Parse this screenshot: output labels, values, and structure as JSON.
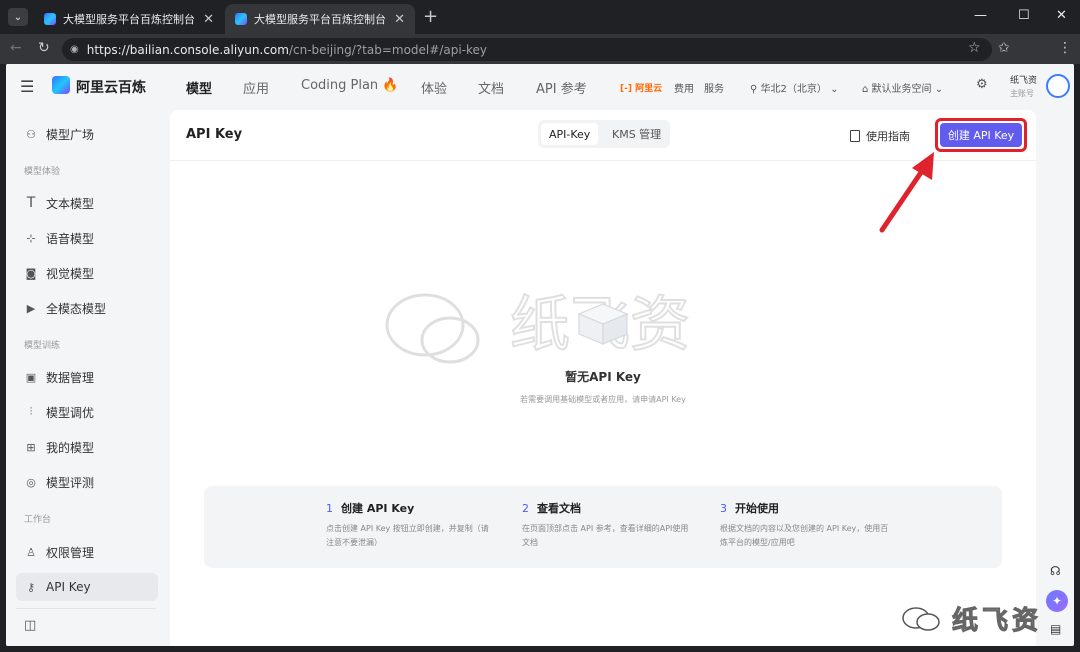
{
  "browser": {
    "tabs": [
      {
        "title": "大模型服务平台百炼控制台"
      },
      {
        "title": "大模型服务平台百炼控制台"
      }
    ],
    "url_host": "https://bailian.console.aliyun.com",
    "url_path": "/cn-beijing/?tab=model#/api-key"
  },
  "topnav": {
    "brand": "阿里云百炼",
    "items": [
      "模型",
      "应用",
      "Coding Plan",
      "体验",
      "文档",
      "API 参考"
    ],
    "aliyun_badge": "[-] 阿里云",
    "fee": "费用",
    "service": "服务",
    "region": "华北2（北京）",
    "workspace": "默认业务空间",
    "user_name": "纸飞资",
    "user_role": "主账号"
  },
  "sidebar": {
    "market": "模型广场",
    "sec_experience": "模型体验",
    "text_model": "文本模型",
    "voice_model": "语音模型",
    "vision_model": "视觉模型",
    "omni_model": "全模态模型",
    "sec_training": "模型训练",
    "data_mgmt": "数据管理",
    "tuning": "模型调优",
    "my_models": "我的模型",
    "evaluation": "模型评测",
    "sec_workspace": "工作台",
    "permissions": "权限管理",
    "api_key": "API Key"
  },
  "main": {
    "title": "API Key",
    "seg_apikey": "API-Key",
    "seg_kms": "KMS 管理",
    "guide": "使用指南",
    "create": "创建 API Key",
    "empty_title": "暂无API Key",
    "empty_sub": "若需要调用基础模型或者应用，请申请API Key",
    "steps": [
      {
        "num": "1",
        "title": "创建 API Key",
        "desc": "点击创建 API Key 按钮立即创建，并复制（请注意不要泄漏）"
      },
      {
        "num": "2",
        "title": "查看文档",
        "desc": "在页面顶部点击 API 参考，查看详细的API使用文档"
      },
      {
        "num": "3",
        "title": "开始使用",
        "desc": "根据文档的内容以及您创建的 API Key，使用百炼平台的模型/应用吧"
      }
    ]
  },
  "watermark": "纸飞资",
  "colors": {
    "primary": "#615ced",
    "highlight": "#e0222c"
  }
}
